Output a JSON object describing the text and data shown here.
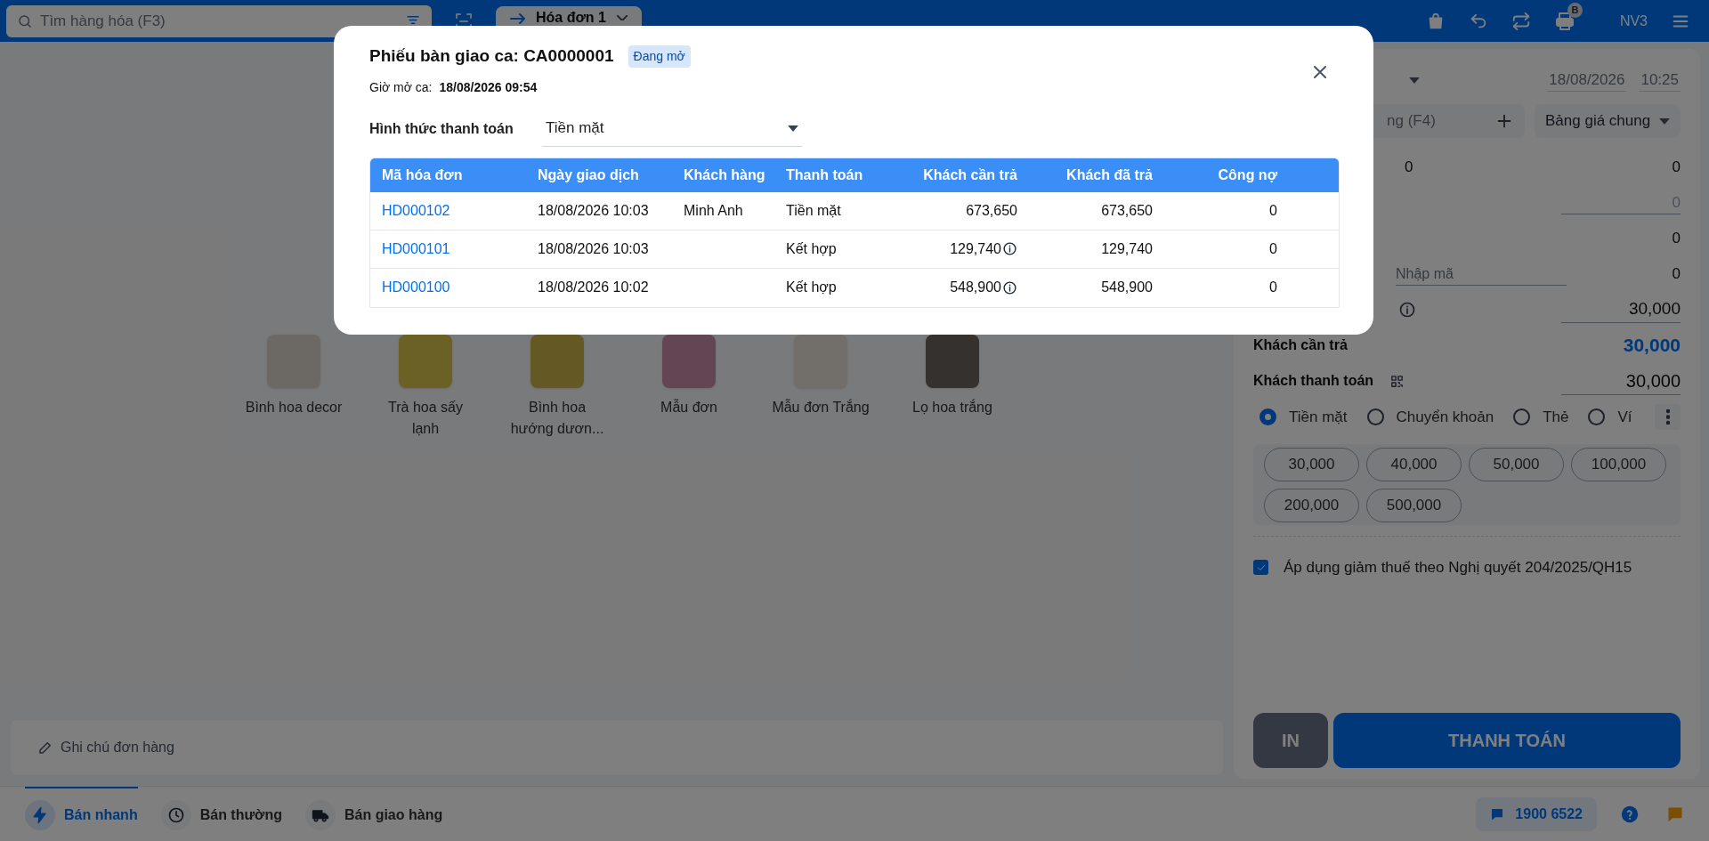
{
  "top_bar": {
    "search": {
      "placeholder": "Tìm hàng hóa (F3)"
    },
    "invoice_tab": {
      "label": "Hóa đơn 1",
      "selected": true
    },
    "printer_badge": "B",
    "user": "NV3"
  },
  "products": [
    {
      "name": "Bình hoa decor"
    },
    {
      "name": "Trà hoa sấy lạnh"
    },
    {
      "name": "Bình hoa hướng dươn..."
    },
    {
      "name": "Mẫu đơn"
    },
    {
      "name": "Mẫu đơn Trắng"
    },
    {
      "name": "Lọ hoa trắng"
    }
  ],
  "order_note": {
    "placeholder": "Ghi chú đơn hàng"
  },
  "right_panel": {
    "date": "18/08/2026",
    "time": "10:25",
    "customer_search": {
      "placeholder": "ng (F4)"
    },
    "price_list": "Bảng giá chung",
    "summary_rows": [
      {
        "kind": "count",
        "count": "0",
        "value": "0"
      },
      {
        "kind": "input",
        "placeholder": "0"
      },
      {
        "kind": "plain",
        "value": "0"
      },
      {
        "kind": "code",
        "placeholder": "Nhập mã",
        "value": "0"
      },
      {
        "kind": "info",
        "value": "30,000"
      },
      {
        "kind": "total",
        "label": "Khách cần trả",
        "value": "30,000"
      },
      {
        "kind": "pay",
        "label": "Khách thanh toán",
        "value": "30,000"
      }
    ],
    "payment_methods": [
      {
        "label": "Tiền mặt",
        "selected": true
      },
      {
        "label": "Chuyển khoản",
        "selected": false
      },
      {
        "label": "Thẻ",
        "selected": false
      },
      {
        "label": "Ví",
        "selected": false
      }
    ],
    "quick_amounts": [
      "30,000",
      "40,000",
      "50,000",
      "100,000",
      "200,000",
      "500,000"
    ],
    "tax_checkbox": {
      "label": "Áp dụng giảm thuế theo Nghị quyết 204/2025/QH15",
      "checked": true
    },
    "print_button": "IN",
    "pay_button": "THANH TOÁN"
  },
  "bottom_bar": {
    "modes": [
      {
        "label": "Bán nhanh",
        "selected": true
      },
      {
        "label": "Bán thường",
        "selected": false
      },
      {
        "label": "Bán giao hàng",
        "selected": false
      }
    ],
    "hotline": "1900 6522"
  },
  "modal": {
    "title": "Phiếu bàn giao ca: CA0000001",
    "status": "Đang mở",
    "open_time_label": "Giờ mở ca:",
    "open_time": "18/08/2026 09:54",
    "payment_filter": {
      "label": "Hình thức thanh toán",
      "value": "Tiền mặt"
    },
    "columns": [
      "Mã hóa đơn",
      "Ngày giao dịch",
      "Khách hàng",
      "Thanh toán",
      "Khách cần trả",
      "Khách đã trả",
      "Công nợ"
    ],
    "rows": [
      {
        "invoice": "HD000102",
        "date": "18/08/2026 10:03",
        "customer": "Minh Anh",
        "payment": "Tiền mặt",
        "due": "673,650",
        "due_info": false,
        "paid": "673,650",
        "debt": "0"
      },
      {
        "invoice": "HD000101",
        "date": "18/08/2026 10:03",
        "payment": "Kết hợp",
        "due": "129,740",
        "due_info": true,
        "paid": "129,740",
        "debt": "0"
      },
      {
        "invoice": "HD000100",
        "date": "18/08/2026 10:02",
        "payment": "Kết hợp",
        "due": "548,900",
        "due_info": true,
        "paid": "548,900",
        "debt": "0"
      }
    ]
  }
}
